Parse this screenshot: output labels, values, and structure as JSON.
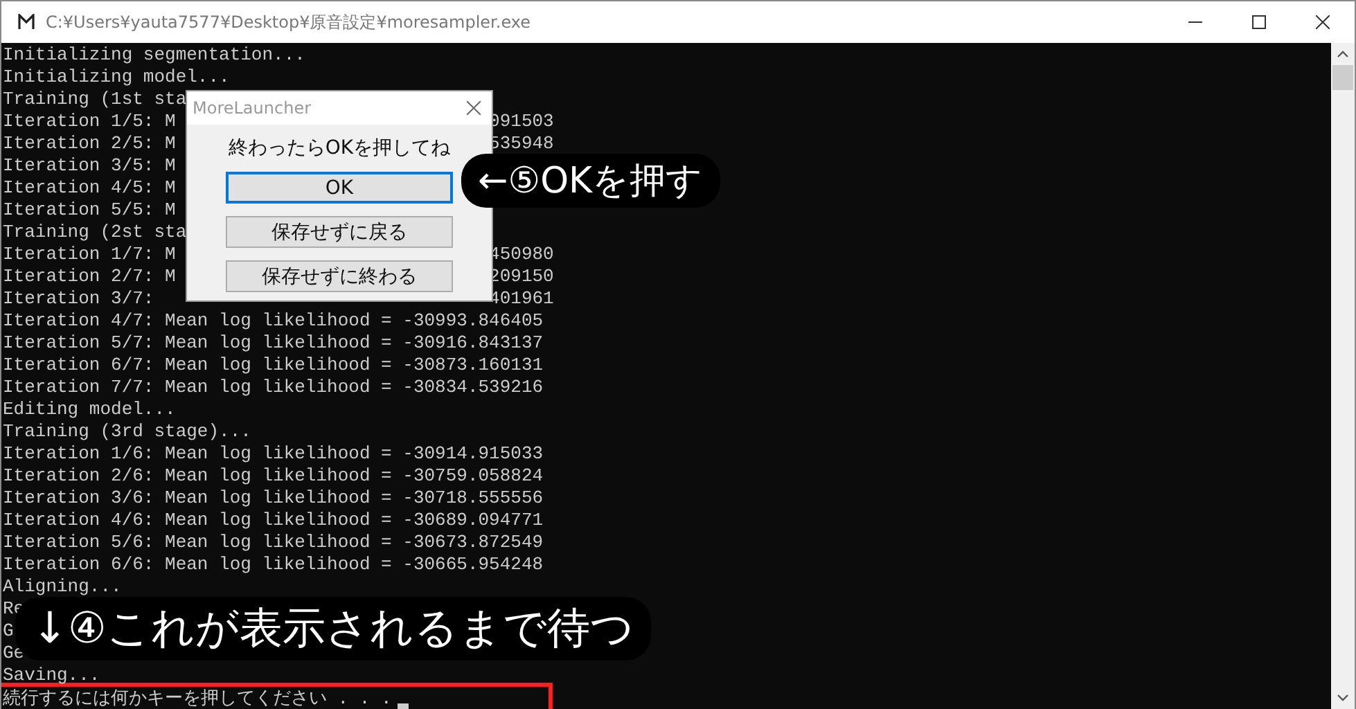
{
  "window": {
    "title": "C:¥Users¥yauta7577¥Desktop¥原音設定¥moresampler.exe"
  },
  "console": {
    "lines": [
      {
        "text": "Initializing segmentation..."
      },
      {
        "text": "Initializing model..."
      },
      {
        "text": "Training (1st sta"
      },
      {
        "text": "Iteration 1/5: M",
        "tail": "091503"
      },
      {
        "text": "Iteration 2/5: M",
        "tail": "535948"
      },
      {
        "text": "Iteration 3/5: M"
      },
      {
        "text": "Iteration 4/5: M"
      },
      {
        "text": "Iteration 5/5: M"
      },
      {
        "text": "Training (2st sta"
      },
      {
        "text": "Iteration 1/7: M",
        "tail": "450980"
      },
      {
        "text": "Iteration 2/7: M",
        "tail": "209150"
      },
      {
        "text": "Iteration 3/7:",
        "tail": "401961"
      },
      {
        "text": "Iteration 4/7: Mean log likelihood = -30993.846405"
      },
      {
        "text": "Iteration 5/7: Mean log likelihood = -30916.843137"
      },
      {
        "text": "Iteration 6/7: Mean log likelihood = -30873.160131"
      },
      {
        "text": "Iteration 7/7: Mean log likelihood = -30834.539216"
      },
      {
        "text": "Editing model..."
      },
      {
        "text": "Training (3rd stage)..."
      },
      {
        "text": "Iteration 1/6: Mean log likelihood = -30914.915033"
      },
      {
        "text": "Iteration 2/6: Mean log likelihood = -30759.058824"
      },
      {
        "text": "Iteration 3/6: Mean log likelihood = -30718.555556"
      },
      {
        "text": "Iteration 4/6: Mean log likelihood = -30689.094771"
      },
      {
        "text": "Iteration 5/6: Mean log likelihood = -30673.872549"
      },
      {
        "text": "Iteration 6/6: Mean log likelihood = -30665.954248"
      },
      {
        "text": "Aligning..."
      },
      {
        "text": "Re"
      },
      {
        "text": "G"
      },
      {
        "text": "Ge"
      },
      {
        "text": "Saving..."
      },
      {
        "text": "続行するには何かキーを押してください . . ."
      }
    ],
    "cursor": true
  },
  "dialog": {
    "title": "MoreLauncher",
    "message": "終わったらOKを押してね",
    "buttons": [
      {
        "label": "OK",
        "focused": true
      },
      {
        "label": "保存せずに戻る",
        "focused": false
      },
      {
        "label": "保存せずに終わる",
        "focused": false
      }
    ]
  },
  "annotations": [
    {
      "kind": "step",
      "text": "←⑤OKを押す"
    },
    {
      "kind": "wait",
      "text": "↓④これが表示されるまで待つ"
    }
  ]
}
